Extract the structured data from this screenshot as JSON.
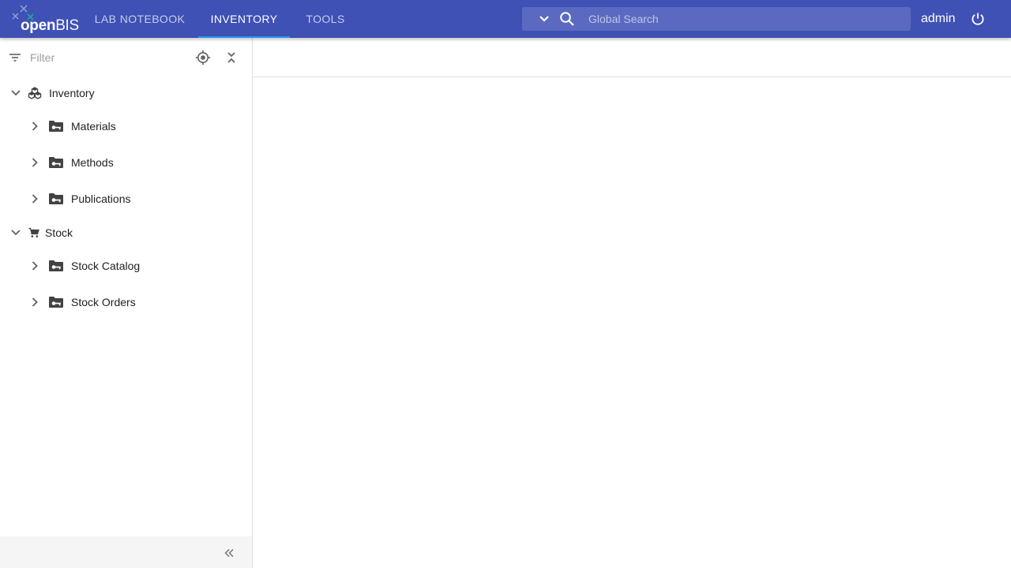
{
  "app": {
    "logo_open": "open",
    "logo_bis": "BIS"
  },
  "nav": {
    "tabs": [
      {
        "label": "LAB NOTEBOOK",
        "active": false
      },
      {
        "label": "INVENTORY",
        "active": true
      },
      {
        "label": "TOOLS",
        "active": false
      }
    ]
  },
  "search": {
    "placeholder": "Global Search",
    "value": ""
  },
  "user": {
    "name": "admin"
  },
  "filter": {
    "placeholder": "Filter",
    "value": ""
  },
  "tree": {
    "nodes": [
      {
        "label": "Inventory",
        "level": 0,
        "expanded": true,
        "icon": "inventory-icon"
      },
      {
        "label": "Materials",
        "level": 1,
        "expanded": false,
        "icon": "folder-key-icon"
      },
      {
        "label": "Methods",
        "level": 1,
        "expanded": false,
        "icon": "folder-key-icon"
      },
      {
        "label": "Publications",
        "level": 1,
        "expanded": false,
        "icon": "folder-key-icon"
      },
      {
        "label": "Stock",
        "level": 0,
        "expanded": true,
        "icon": "cart-icon"
      },
      {
        "label": "Stock Catalog",
        "level": 1,
        "expanded": false,
        "icon": "folder-key-icon"
      },
      {
        "label": "Stock Orders",
        "level": 1,
        "expanded": false,
        "icon": "folder-key-icon"
      }
    ]
  },
  "colors": {
    "topbar": "#3f51b5",
    "tab_indicator": "#2196f3",
    "icon_dark": "#424242"
  }
}
